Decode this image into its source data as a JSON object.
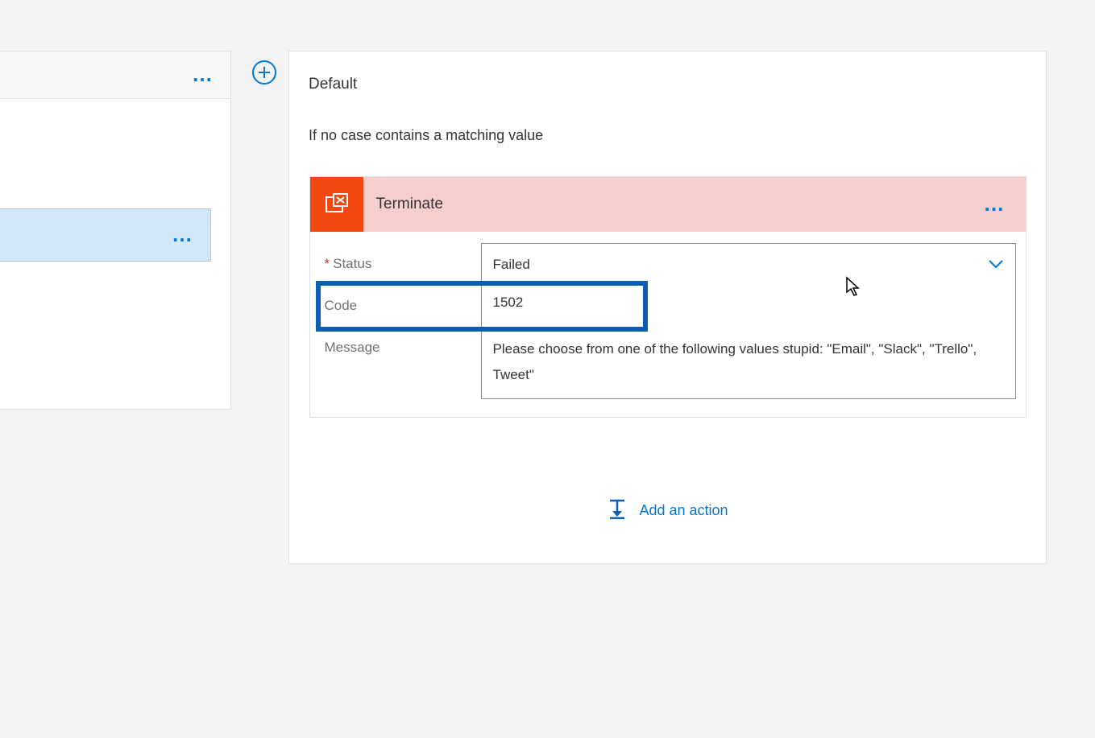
{
  "left": {
    "gray_ellipsis": "…",
    "blue_ellipsis": "…"
  },
  "default_card": {
    "title": "Default",
    "subtitle": "If no case contains a matching value"
  },
  "terminate": {
    "title": "Terminate",
    "ellipsis": "…",
    "fields": {
      "status": {
        "label": "Status",
        "value": "Failed"
      },
      "code": {
        "label": "Code",
        "value": "1502"
      },
      "message": {
        "label": "Message",
        "value": "Please choose from one of the following values stupid: \"Email\", \"Slack\", \"Trello\", Tweet\""
      }
    }
  },
  "add_action": {
    "label": "Add an action"
  }
}
